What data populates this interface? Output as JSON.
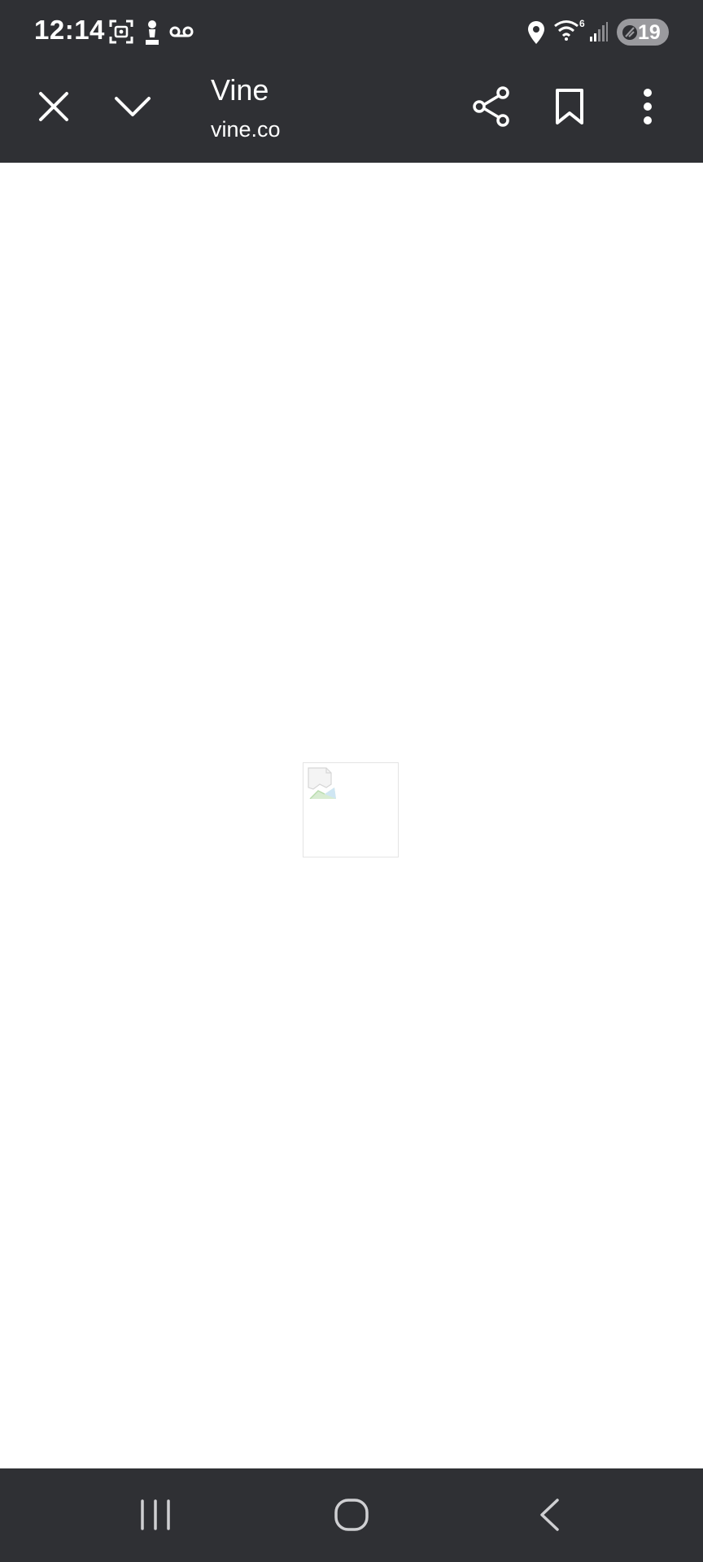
{
  "status_bar": {
    "time": "12:14",
    "battery_level": "19",
    "icons": [
      "screenshot-icon",
      "chess-pawn-icon",
      "voicemail-icon",
      "location-icon",
      "wifi-6-icon",
      "cell-signal-icon",
      "battery-saver-icon"
    ]
  },
  "toolbar": {
    "title": "Vine",
    "url": "vine.co",
    "icons": [
      "close-icon",
      "chevron-down-icon",
      "share-icon",
      "bookmark-icon",
      "more-vert-icon"
    ]
  },
  "content": {
    "image_state": "broken-image-icon"
  },
  "nav_bar": {
    "icons": [
      "recent-apps-icon",
      "home-icon",
      "back-icon"
    ]
  },
  "colors": {
    "chrome_background": "#2f3034",
    "page_background": "#ffffff",
    "icon_color": "#ffffff"
  }
}
